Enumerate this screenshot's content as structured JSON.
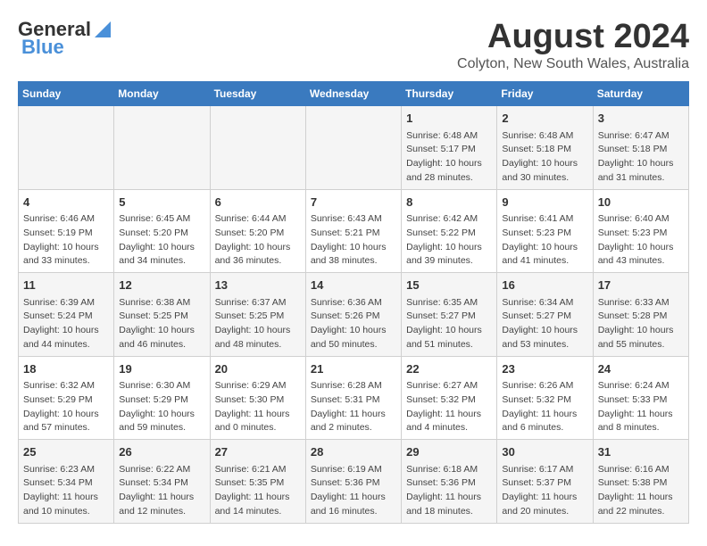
{
  "header": {
    "logo_line1": "General",
    "logo_line2": "Blue",
    "main_title": "August 2024",
    "sub_title": "Colyton, New South Wales, Australia"
  },
  "days_of_week": [
    "Sunday",
    "Monday",
    "Tuesday",
    "Wednesday",
    "Thursday",
    "Friday",
    "Saturday"
  ],
  "weeks": [
    [
      {
        "day": "",
        "info": ""
      },
      {
        "day": "",
        "info": ""
      },
      {
        "day": "",
        "info": ""
      },
      {
        "day": "",
        "info": ""
      },
      {
        "day": "1",
        "info": "Sunrise: 6:48 AM\nSunset: 5:17 PM\nDaylight: 10 hours\nand 28 minutes."
      },
      {
        "day": "2",
        "info": "Sunrise: 6:48 AM\nSunset: 5:18 PM\nDaylight: 10 hours\nand 30 minutes."
      },
      {
        "day": "3",
        "info": "Sunrise: 6:47 AM\nSunset: 5:18 PM\nDaylight: 10 hours\nand 31 minutes."
      }
    ],
    [
      {
        "day": "4",
        "info": "Sunrise: 6:46 AM\nSunset: 5:19 PM\nDaylight: 10 hours\nand 33 minutes."
      },
      {
        "day": "5",
        "info": "Sunrise: 6:45 AM\nSunset: 5:20 PM\nDaylight: 10 hours\nand 34 minutes."
      },
      {
        "day": "6",
        "info": "Sunrise: 6:44 AM\nSunset: 5:20 PM\nDaylight: 10 hours\nand 36 minutes."
      },
      {
        "day": "7",
        "info": "Sunrise: 6:43 AM\nSunset: 5:21 PM\nDaylight: 10 hours\nand 38 minutes."
      },
      {
        "day": "8",
        "info": "Sunrise: 6:42 AM\nSunset: 5:22 PM\nDaylight: 10 hours\nand 39 minutes."
      },
      {
        "day": "9",
        "info": "Sunrise: 6:41 AM\nSunset: 5:23 PM\nDaylight: 10 hours\nand 41 minutes."
      },
      {
        "day": "10",
        "info": "Sunrise: 6:40 AM\nSunset: 5:23 PM\nDaylight: 10 hours\nand 43 minutes."
      }
    ],
    [
      {
        "day": "11",
        "info": "Sunrise: 6:39 AM\nSunset: 5:24 PM\nDaylight: 10 hours\nand 44 minutes."
      },
      {
        "day": "12",
        "info": "Sunrise: 6:38 AM\nSunset: 5:25 PM\nDaylight: 10 hours\nand 46 minutes."
      },
      {
        "day": "13",
        "info": "Sunrise: 6:37 AM\nSunset: 5:25 PM\nDaylight: 10 hours\nand 48 minutes."
      },
      {
        "day": "14",
        "info": "Sunrise: 6:36 AM\nSunset: 5:26 PM\nDaylight: 10 hours\nand 50 minutes."
      },
      {
        "day": "15",
        "info": "Sunrise: 6:35 AM\nSunset: 5:27 PM\nDaylight: 10 hours\nand 51 minutes."
      },
      {
        "day": "16",
        "info": "Sunrise: 6:34 AM\nSunset: 5:27 PM\nDaylight: 10 hours\nand 53 minutes."
      },
      {
        "day": "17",
        "info": "Sunrise: 6:33 AM\nSunset: 5:28 PM\nDaylight: 10 hours\nand 55 minutes."
      }
    ],
    [
      {
        "day": "18",
        "info": "Sunrise: 6:32 AM\nSunset: 5:29 PM\nDaylight: 10 hours\nand 57 minutes."
      },
      {
        "day": "19",
        "info": "Sunrise: 6:30 AM\nSunset: 5:29 PM\nDaylight: 10 hours\nand 59 minutes."
      },
      {
        "day": "20",
        "info": "Sunrise: 6:29 AM\nSunset: 5:30 PM\nDaylight: 11 hours\nand 0 minutes."
      },
      {
        "day": "21",
        "info": "Sunrise: 6:28 AM\nSunset: 5:31 PM\nDaylight: 11 hours\nand 2 minutes."
      },
      {
        "day": "22",
        "info": "Sunrise: 6:27 AM\nSunset: 5:32 PM\nDaylight: 11 hours\nand 4 minutes."
      },
      {
        "day": "23",
        "info": "Sunrise: 6:26 AM\nSunset: 5:32 PM\nDaylight: 11 hours\nand 6 minutes."
      },
      {
        "day": "24",
        "info": "Sunrise: 6:24 AM\nSunset: 5:33 PM\nDaylight: 11 hours\nand 8 minutes."
      }
    ],
    [
      {
        "day": "25",
        "info": "Sunrise: 6:23 AM\nSunset: 5:34 PM\nDaylight: 11 hours\nand 10 minutes."
      },
      {
        "day": "26",
        "info": "Sunrise: 6:22 AM\nSunset: 5:34 PM\nDaylight: 11 hours\nand 12 minutes."
      },
      {
        "day": "27",
        "info": "Sunrise: 6:21 AM\nSunset: 5:35 PM\nDaylight: 11 hours\nand 14 minutes."
      },
      {
        "day": "28",
        "info": "Sunrise: 6:19 AM\nSunset: 5:36 PM\nDaylight: 11 hours\nand 16 minutes."
      },
      {
        "day": "29",
        "info": "Sunrise: 6:18 AM\nSunset: 5:36 PM\nDaylight: 11 hours\nand 18 minutes."
      },
      {
        "day": "30",
        "info": "Sunrise: 6:17 AM\nSunset: 5:37 PM\nDaylight: 11 hours\nand 20 minutes."
      },
      {
        "day": "31",
        "info": "Sunrise: 6:16 AM\nSunset: 5:38 PM\nDaylight: 11 hours\nand 22 minutes."
      }
    ]
  ]
}
